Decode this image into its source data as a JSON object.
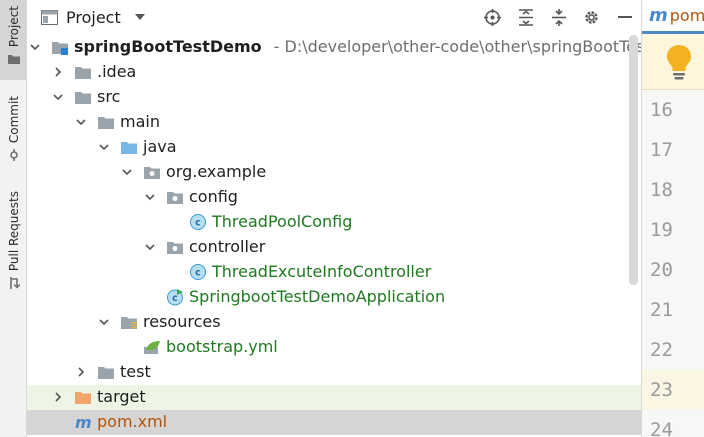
{
  "side_strip": {
    "tabs": [
      {
        "label": "Project",
        "icon": "folder-icon",
        "active": true
      },
      {
        "label": "Commit",
        "icon": "commit-icon",
        "active": false
      },
      {
        "label": "Pull Requests",
        "icon": "pull-request-icon",
        "active": false
      }
    ]
  },
  "panel": {
    "title": "Project",
    "tools": [
      "locate-icon",
      "expand-all-icon",
      "collapse-all-icon",
      "settings-icon",
      "hide-icon"
    ]
  },
  "tree": [
    {
      "level": 0,
      "arrow": "down",
      "icon": "module",
      "label": "springBootTestDemo",
      "path": "- D:\\developer\\other-code\\other\\springBootTestDemo",
      "style": "bold"
    },
    {
      "level": 1,
      "arrow": "right",
      "icon": "folder-grey",
      "label": ".idea",
      "style": ""
    },
    {
      "level": 1,
      "arrow": "down",
      "icon": "folder-grey",
      "label": "src",
      "style": ""
    },
    {
      "level": 2,
      "arrow": "down",
      "icon": "folder-grey",
      "label": "main",
      "style": ""
    },
    {
      "level": 3,
      "arrow": "down",
      "icon": "folder-blue",
      "label": "java",
      "style": ""
    },
    {
      "level": 4,
      "arrow": "down",
      "icon": "package",
      "label": "org.example",
      "style": ""
    },
    {
      "level": 5,
      "arrow": "down",
      "icon": "package",
      "label": "config",
      "style": ""
    },
    {
      "level": 6,
      "arrow": "",
      "icon": "class",
      "label": "ThreadPoolConfig",
      "style": "green"
    },
    {
      "level": 5,
      "arrow": "down",
      "icon": "package",
      "label": "controller",
      "style": ""
    },
    {
      "level": 6,
      "arrow": "",
      "icon": "class",
      "label": "ThreadExcuteInfoController",
      "style": "green"
    },
    {
      "level": 5,
      "arrow": "",
      "icon": "boot-class",
      "label": "SpringbootTestDemoApplication",
      "style": "green"
    },
    {
      "level": 3,
      "arrow": "down",
      "icon": "folder-resources",
      "label": "resources",
      "style": ""
    },
    {
      "level": 4,
      "arrow": "",
      "icon": "spring-yml",
      "label": "bootstrap.yml",
      "style": "green"
    },
    {
      "level": 2,
      "arrow": "right",
      "icon": "folder-grey",
      "label": "test",
      "style": ""
    },
    {
      "level": 1,
      "arrow": "right",
      "icon": "folder-orange",
      "label": "target",
      "style": "",
      "highlight": "green"
    },
    {
      "level": 1,
      "arrow": "",
      "icon": "maven",
      "label": "pom.xml",
      "style": "orange",
      "highlight": "grey"
    }
  ],
  "editor": {
    "tab_prefix": "m",
    "tab_name": "pom.xml",
    "line_numbers": [
      "16",
      "17",
      "18",
      "19",
      "20",
      "21",
      "22",
      "23",
      "24"
    ],
    "current_line": "23"
  },
  "colors": {
    "accent": "#4a88c7",
    "class_green": "#1f7a1f",
    "target_orange": "#f2a56b",
    "selection_grey": "#d5d5d5",
    "highlight_green": "#eef5e4"
  }
}
